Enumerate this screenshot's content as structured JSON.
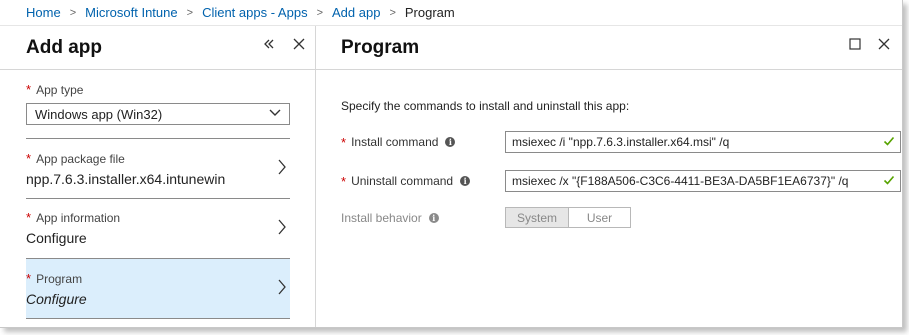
{
  "breadcrumb": {
    "items": [
      "Home",
      "Microsoft Intune",
      "Client apps - Apps",
      "Add app"
    ],
    "current": "Program",
    "separator": ">"
  },
  "left_blade": {
    "title": "Add app",
    "app_type": {
      "label": "App type",
      "value": "Windows app (Win32)"
    },
    "nav": [
      {
        "label": "App package file",
        "value": "npp.7.6.3.installer.x64.intunewin"
      },
      {
        "label": "App information",
        "value": "Configure"
      },
      {
        "label": "Program",
        "value": "Configure",
        "selected": true
      }
    ]
  },
  "right_blade": {
    "title": "Program",
    "instructions": "Specify the commands to install and uninstall this app:",
    "install": {
      "label": "Install command",
      "value": "msiexec /i \"npp.7.6.3.installer.x64.msi\" /q"
    },
    "uninstall": {
      "label": "Uninstall command",
      "value": "msiexec /x \"{F188A506-C3C6-4411-BE3A-DA5BF1EA6737}\" /q"
    },
    "behavior": {
      "label": "Install behavior",
      "options": [
        "System",
        "User"
      ],
      "selected": "System"
    }
  },
  "colors": {
    "link": "#0062ad",
    "required": "#cc0000",
    "selected_bg": "#dbeefc",
    "valid_check": "#57a300"
  }
}
